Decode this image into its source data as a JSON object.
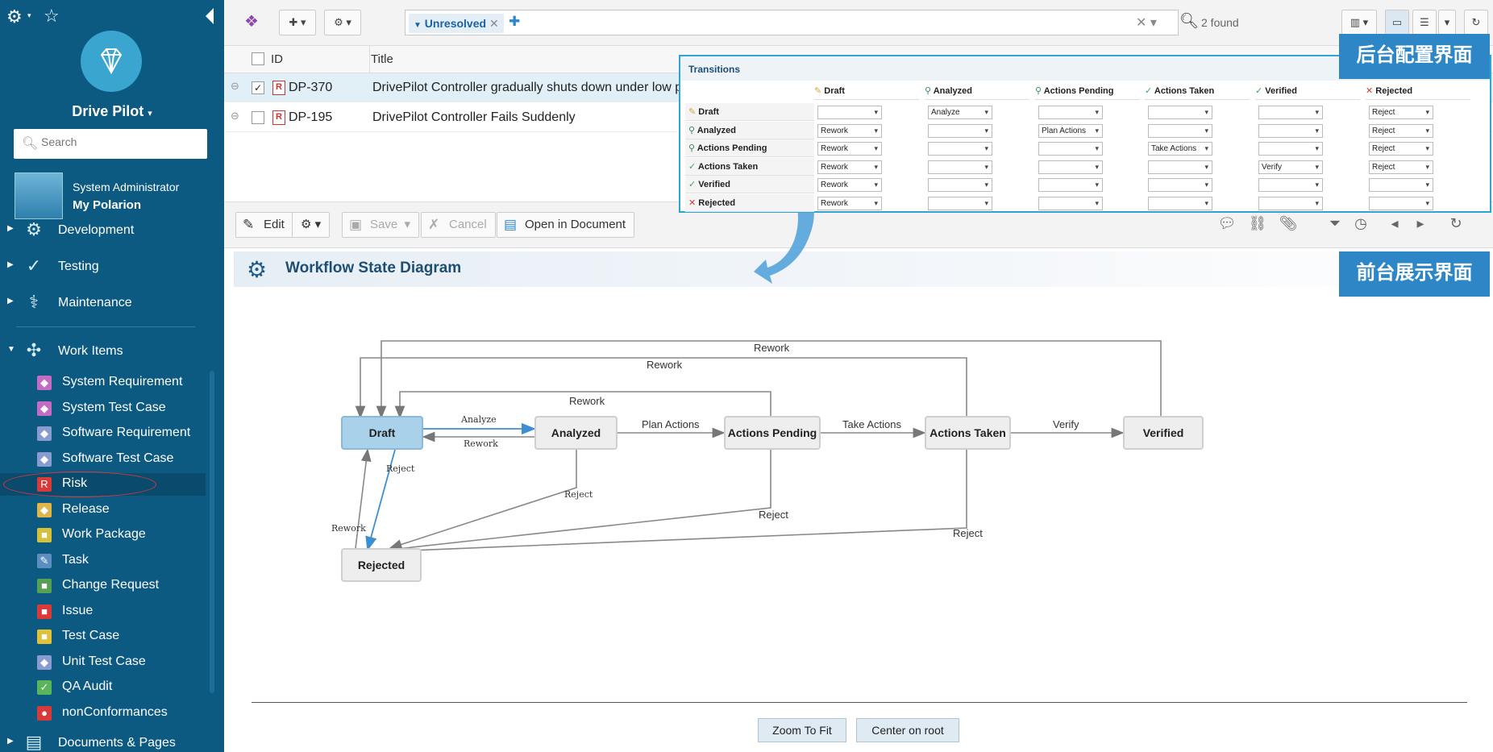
{
  "sidebar": {
    "project_name": "Drive Pilot",
    "search_placeholder": "Search",
    "user_role": "System Administrator",
    "user_link": "My Polarion",
    "sections": [
      {
        "label": "Development"
      },
      {
        "label": "Testing"
      },
      {
        "label": "Maintenance"
      },
      {
        "label": "Work Items"
      }
    ],
    "work_items": [
      {
        "label": "System Requirement",
        "color": "#c46bc4"
      },
      {
        "label": "System Test Case",
        "color": "#c46bc4"
      },
      {
        "label": "Software Requirement",
        "color": "#8a9bd0"
      },
      {
        "label": "Software Test Case",
        "color": "#8a9bd0"
      },
      {
        "label": "Risk",
        "color": "#d83a3a"
      },
      {
        "label": "Release",
        "color": "#e0b64a"
      },
      {
        "label": "Work Package",
        "color": "#d6c23a"
      },
      {
        "label": "Task",
        "color": "#5a8fc0"
      },
      {
        "label": "Change Request",
        "color": "#55a055"
      },
      {
        "label": "Issue",
        "color": "#d83a3a"
      },
      {
        "label": "Test Case",
        "color": "#e0c23a"
      },
      {
        "label": "Unit Test Case",
        "color": "#8a9bd0"
      },
      {
        "label": "QA Audit",
        "color": "#5ab55a"
      },
      {
        "label": "nonConformances",
        "color": "#d83a3a"
      }
    ],
    "bottom_item": "Documents & Pages"
  },
  "toolbar": {
    "query_chip": "Unresolved",
    "found": "2 found"
  },
  "table": {
    "headers": {
      "id": "ID",
      "title": "Title"
    },
    "rows": [
      {
        "id": "DP-370",
        "title": "DrivePilot Controller gradually shuts down under low pow",
        "checked": "✓"
      },
      {
        "id": "DP-195",
        "title": "DrivePilot Controller Fails Suddenly",
        "checked": ""
      }
    ]
  },
  "detail_toolbar": {
    "edit": "Edit",
    "save": "Save",
    "cancel": "Cancel",
    "open_doc": "Open in Document"
  },
  "section_title": "Workflow State Diagram",
  "diagram": {
    "nodes": [
      "Draft",
      "Analyzed",
      "Actions Pending",
      "Actions Taken",
      "Verified",
      "Rejected"
    ],
    "edge_labels": {
      "rework_top": "Rework",
      "rework_mid": "Rework",
      "rework_low": "Rework",
      "analyze": "Analyze",
      "rework_back": "Rework",
      "plan_actions": "Plan Actions",
      "take_actions": "Take Actions",
      "verify": "Verify",
      "reject_draft": "Reject",
      "reject_analyzed": "Reject",
      "reject_pending": "Reject",
      "reject_taken": "Reject",
      "rework_rejected": "Rework"
    }
  },
  "buttons": {
    "zoom": "Zoom To Fit",
    "center": "Center on root"
  },
  "transitions": {
    "title": "Transitions",
    "columns": [
      "Draft",
      "Analyzed",
      "Actions Pending",
      "Actions Taken",
      "Verified",
      "Rejected"
    ],
    "rows": [
      {
        "label": "Draft",
        "cells": [
          "",
          "Analyze",
          "",
          "",
          "",
          "Reject"
        ]
      },
      {
        "label": "Analyzed",
        "cells": [
          "Rework",
          "",
          "Plan Actions",
          "",
          "",
          "Reject"
        ]
      },
      {
        "label": "Actions Pending",
        "cells": [
          "Rework",
          "",
          "",
          "Take Actions",
          "",
          "Reject"
        ]
      },
      {
        "label": "Actions Taken",
        "cells": [
          "Rework",
          "",
          "",
          "",
          "Verify",
          "Reject"
        ]
      },
      {
        "label": "Verified",
        "cells": [
          "Rework",
          "",
          "",
          "",
          "",
          ""
        ]
      },
      {
        "label": "Rejected",
        "cells": [
          "Rework",
          "",
          "",
          "",
          "",
          ""
        ]
      }
    ]
  },
  "badges": {
    "backend": "后台配置界面",
    "frontend": "前台展示界面"
  }
}
